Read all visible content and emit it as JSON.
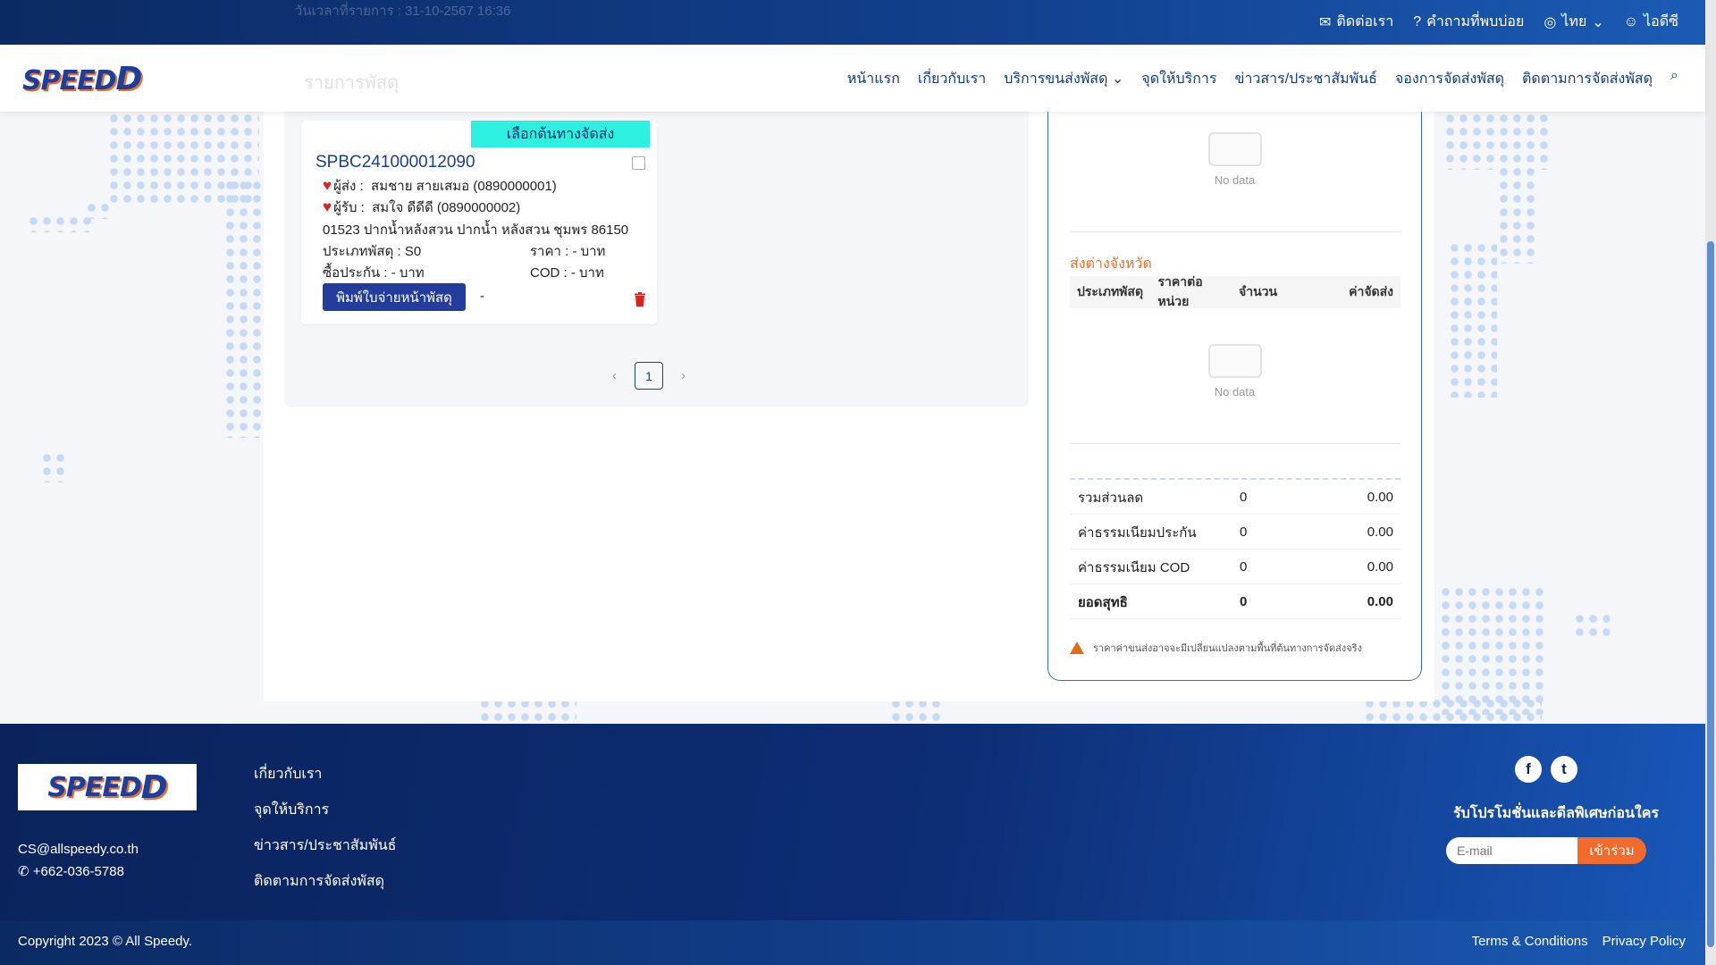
{
  "topbar": {
    "contact": "ติดต่อเรา",
    "faq": "คำถามที่พบบ่อย",
    "language": "ไทย",
    "user": "ไอดีซี",
    "ghost_text": "วันเวลาที่รายการ : 31-10-2567 16:36"
  },
  "nav": {
    "logo": "SPEED",
    "items": [
      "หน้าแรก",
      "เกี่ยวกับเรา",
      "บริการขนส่งพัสดุ",
      "จุดให้บริการ",
      "ข่าวสาร/ประชาสัมพันธ์",
      "จองการจัดส่งพัสดุ",
      "ติดตามการจัดส่งพัสดุ"
    ],
    "ghost_title": "รายการพัสดุ"
  },
  "card": {
    "origin_button": "เลือกต้นทางจัดส่ง",
    "tracking_id": "SPBC241000012090",
    "sender_label": "ผู้ส่ง :",
    "sender_value": "สมชาย สายเสมอ  (0890000001)",
    "receiver_label": "ผู้รับ :",
    "receiver_value": "สมใจ ดีดีดี  (0890000002)",
    "address": "01523 ปากน้ำหลังสวน ปากน้ำ หลังสวน ชุมพร 86150",
    "parcel_type": "ประเภทพัสดุ : S0",
    "price": "ราคา : - บาท",
    "insurance": "ซื้อประกัน : - บาท",
    "cod": "COD : - บาท",
    "print_button": "พิมพ์ใบจ่ายหน้าพัสดุ",
    "dash": "-"
  },
  "pager": {
    "current": "1",
    "prev": "‹",
    "next": "›"
  },
  "summary": {
    "no_data": "No data",
    "section_title": "ส่งต่างจังหวัด",
    "columns": [
      "ประเภทพัสดุ",
      "ราคาต่อหน่วย",
      "จำนวน",
      "ค่าจัดส่ง"
    ],
    "rows": [
      {
        "label": "รวมส่วนลด",
        "count": "0",
        "amount": "0.00"
      },
      {
        "label": "ค่าธรรมเนียมประกัน",
        "count": "0",
        "amount": "0.00"
      },
      {
        "label": "ค่าธรรมเนียม COD",
        "count": "0",
        "amount": "0.00"
      },
      {
        "label": "ยอดสุทธิ",
        "count": "0",
        "amount": "0.00"
      }
    ],
    "warning": "ราคาค่าขนส่งอาจจะมีเปลี่ยนแปลงตามพื้นที่ต้นทางการจัดส่งจริง"
  },
  "footer": {
    "email": "CS@allspeedy.co.th",
    "phone": "+662-036-5788",
    "links": [
      "เกี่ยวกับเรา",
      "จุดให้บริการ",
      "ข่าวสาร/ประชาสัมพันธ์",
      "ติดตามการจัดส่งพัสดุ"
    ],
    "promo": "รับโปรโมชั่นและดีลพิเศษก่อนใคร",
    "email_placeholder": "E-mail",
    "join_button": "เข้าร่วม",
    "copyright": "Copyright 2023 © All Speedy.",
    "terms": "Terms & Conditions",
    "privacy": "Privacy Policy"
  }
}
